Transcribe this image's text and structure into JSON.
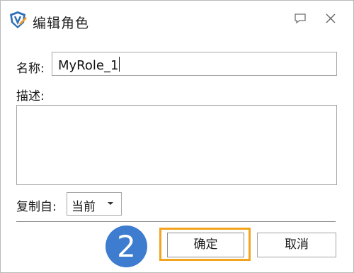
{
  "window": {
    "title": "编辑角色",
    "icon": "edit-role-shield-icon",
    "controls": {
      "help": "help-comment-icon",
      "close": "close-icon"
    }
  },
  "form": {
    "name_label": "名称:",
    "name_value": "MyRole_1",
    "description_label": "描述:",
    "description_value": "",
    "copy_from_label": "复制自:",
    "copy_from_value": "当前"
  },
  "annotation": {
    "step_number": "2",
    "highlight_color": "#f2a41e",
    "badge_color": "#3d7ccf"
  },
  "buttons": {
    "ok_label": "确定",
    "cancel_label": "取消"
  }
}
